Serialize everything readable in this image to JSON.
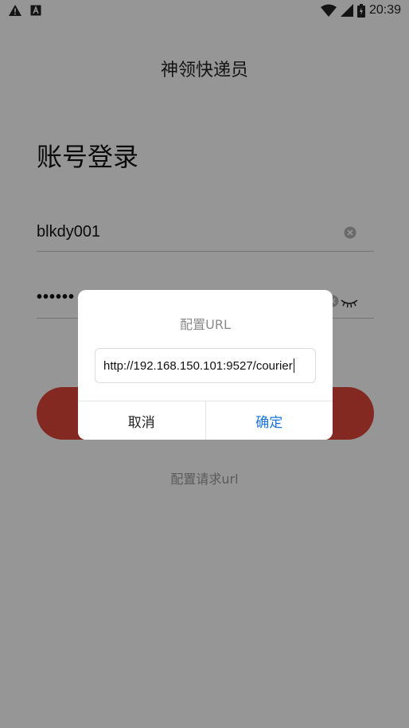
{
  "status_bar": {
    "time": "20:39",
    "left_icons": [
      "warning-icon",
      "font-a-icon"
    ],
    "right_icons": [
      "wifi-icon",
      "signal-icon",
      "battery-icon"
    ]
  },
  "app": {
    "title": "神领快递员"
  },
  "login": {
    "heading": "账号登录",
    "username_value": "blkdy001",
    "password_value": "••••••",
    "clear_icon": "clear-circle-icon",
    "eye_icon": "eye-closed-icon",
    "button_color": "#e0443a",
    "config_link": "配置请求url"
  },
  "dialog": {
    "title": "配置URL",
    "url_value": "http://192.168.150.101:9527/courier",
    "cancel_label": "取消",
    "confirm_label": "确定",
    "confirm_color": "#1a73d9"
  }
}
